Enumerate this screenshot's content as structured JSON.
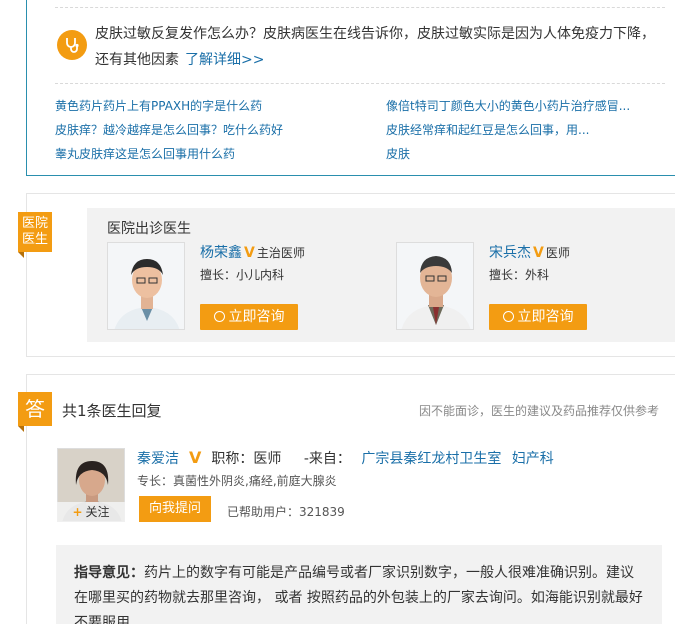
{
  "promo": {
    "text": "皮肤过敏反复发作怎么办？皮肤病医生在线告诉你，皮肤过敏实际是因为人体免疫力下降，还有其他因素",
    "link": "了解详细>>"
  },
  "related_links": [
    "黄色药片药片上有PPAXH的字是什么药",
    "像倍t特司丁颜色大小的黄色小药片治疗感冒...",
    "皮肤痒？越冷越痒是怎么回事？吃什么药好",
    "皮肤经常痒和起红豆是怎么回事，用...",
    "睾丸皮肤痒这是怎么回事用什么药",
    "皮肤"
  ],
  "hospital": {
    "tag": "医院医生",
    "title": "医院出诊医生",
    "doctors": [
      {
        "name": "杨荣鑫",
        "v": "V",
        "title": "主治医师",
        "specialty": "擅长：小儿内科",
        "button": "立即咨询"
      },
      {
        "name": "宋兵杰",
        "v": "V",
        "title": "医师",
        "specialty": "擅长：外科",
        "button": "立即咨询"
      }
    ]
  },
  "answers": {
    "tag": "答",
    "title": "共1条医生回复",
    "disclaimer": "因不能面诊，医生的建议及药品推荐仅供参考",
    "responder": {
      "name": "秦爱洁",
      "v": "V",
      "title_label": "职称：医师",
      "from_label": "-来自：",
      "hospital": "广宗县秦红龙村卫生室",
      "department": "妇产科",
      "specialty": "专长：真菌性外阴炎,痛经,前庭大腺炎",
      "follow": "关注",
      "follow_plus": "+",
      "ask_button": "向我提问",
      "helped": "已帮助用户：321839"
    },
    "advice_label": "指导意见：",
    "advice_text": "药片上的数字有可能是产品编号或者厂家识别数字，一般人很难准确识别。建议在哪里买的药物就去那里咨询， 或者 按照药品的外包装上的厂家去询问。如海能识别就最好不要服用"
  },
  "colors": {
    "accent": "#f39c12",
    "link": "#1a6fa8",
    "border": "#2a8fae"
  }
}
